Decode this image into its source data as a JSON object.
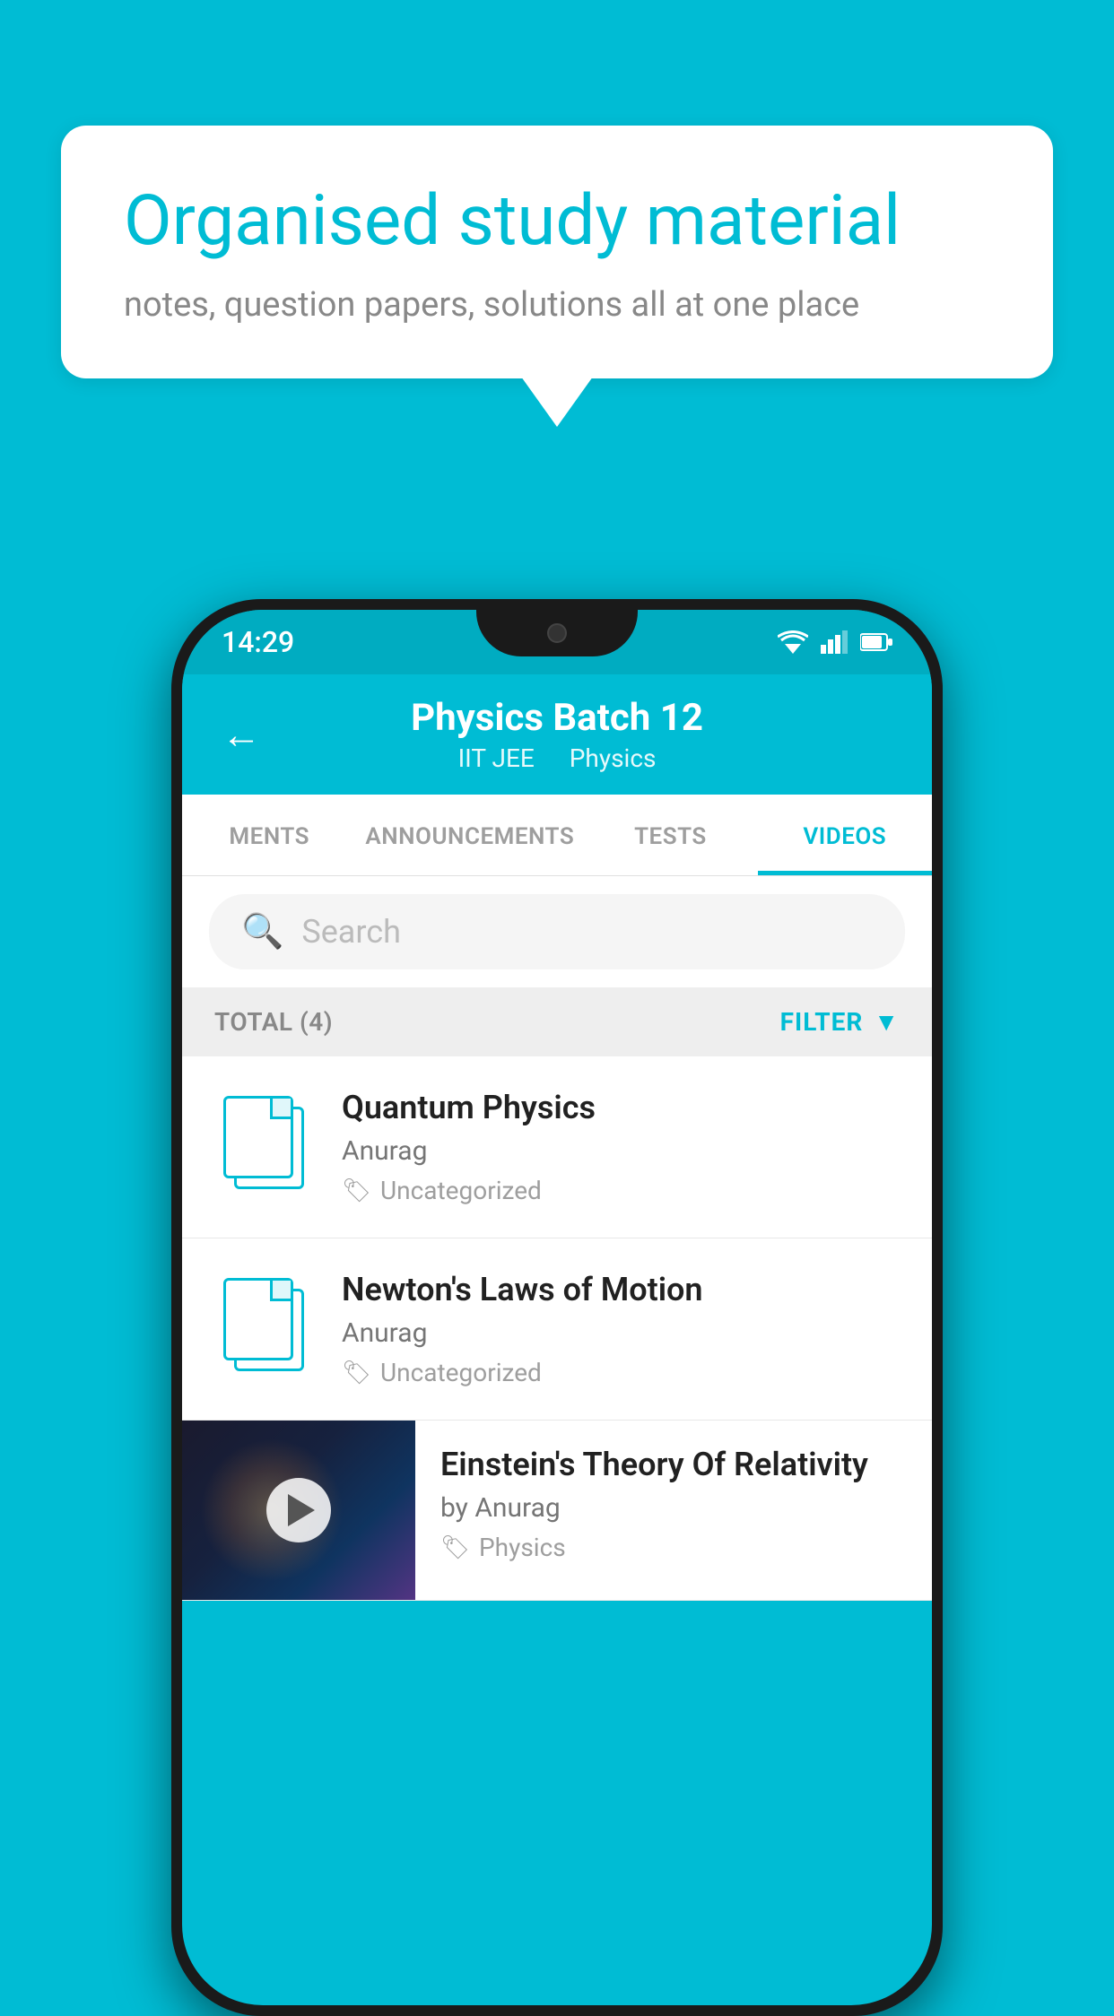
{
  "background_color": "#00bcd4",
  "speech_bubble": {
    "title": "Organised study material",
    "subtitle": "notes, question papers, solutions all at one place"
  },
  "status_bar": {
    "time": "14:29"
  },
  "app_header": {
    "title": "Physics Batch 12",
    "subtitle_part1": "IIT JEE",
    "subtitle_part2": "Physics",
    "back_label": "←"
  },
  "tabs": [
    {
      "label": "MENTS",
      "active": false
    },
    {
      "label": "ANNOUNCEMENTS",
      "active": false
    },
    {
      "label": "TESTS",
      "active": false
    },
    {
      "label": "VIDEOS",
      "active": true
    }
  ],
  "search": {
    "placeholder": "Search"
  },
  "filter_bar": {
    "total_label": "TOTAL (4)",
    "filter_label": "FILTER"
  },
  "video_items": [
    {
      "title": "Quantum Physics",
      "author": "Anurag",
      "tag": "Uncategorized",
      "has_thumbnail": false
    },
    {
      "title": "Newton's Laws of Motion",
      "author": "Anurag",
      "tag": "Uncategorized",
      "has_thumbnail": false
    },
    {
      "title": "Einstein's Theory Of Relativity",
      "author": "by Anurag",
      "tag": "Physics",
      "has_thumbnail": true
    }
  ]
}
